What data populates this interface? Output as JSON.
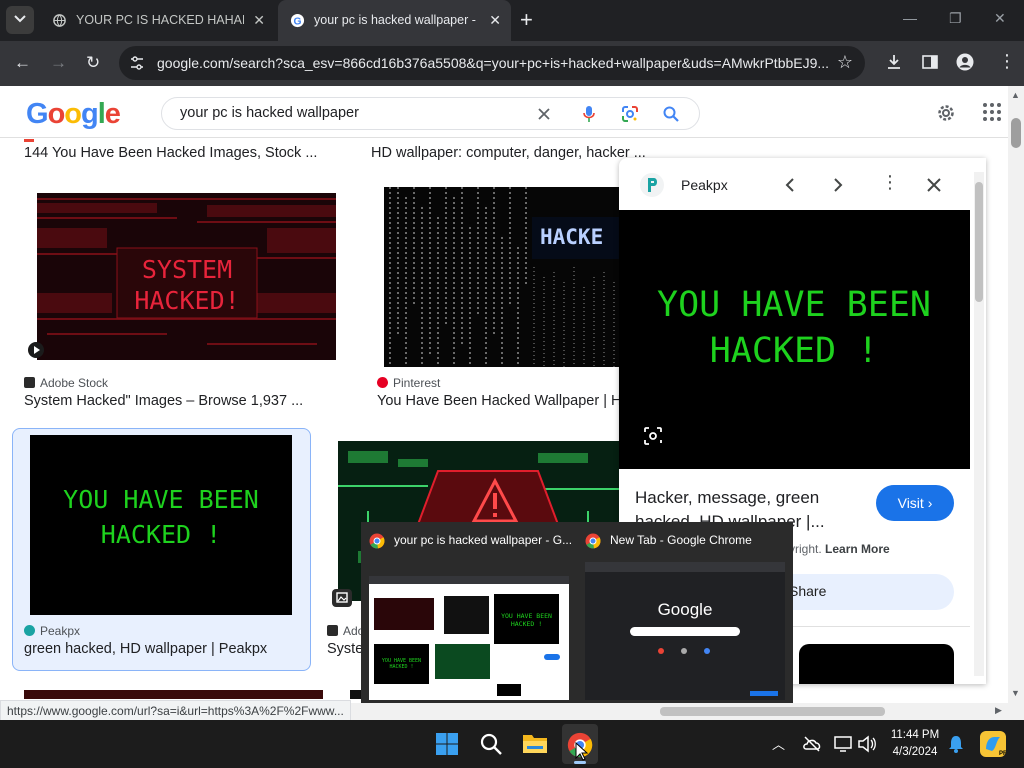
{
  "browser": {
    "tabs": [
      {
        "title": "YOUR PC IS HACKED HAHAHAHAHA",
        "active": false
      },
      {
        "title": "your pc is hacked wallpaper - Google Search",
        "active": true
      }
    ],
    "new_tab_symbol": "+",
    "url": "google.com/search?sca_esv=866cd16b376a5508&q=your+pc+is+hacked+wallpaper&uds=AMwkrPtbbEJ9..."
  },
  "google": {
    "logo": {
      "G": "G",
      "o1": "o",
      "o2": "o",
      "g": "g",
      "l": "l",
      "e": "e"
    },
    "query": "your pc is hacked wallpaper"
  },
  "results": {
    "top_row": [
      {
        "title": "144 You Have Been Hacked Images, Stock ..."
      },
      {
        "title": "HD wallpaper: computer, danger, hacker ..."
      }
    ],
    "row1": [
      {
        "source": "Adobe Stock",
        "title": "System Hacked\" Images – Browse 1,937 ...",
        "image_text": [
          "SYSTEM",
          "HACKED!"
        ]
      },
      {
        "source": "Pinterest",
        "title": "You Have Been Hacked Wallpaper | Ha",
        "image_text": "HACKE"
      }
    ],
    "row2": [
      {
        "source": "Peakpx",
        "title": "green hacked, HD wallpaper | Peakpx",
        "image_text": [
          "YOU HAVE BEEN",
          "HACKED !"
        ]
      },
      {
        "source": "Adobe Stock",
        "source_visible": "Ado",
        "title_visible": "Syste"
      }
    ]
  },
  "preview_panel": {
    "source": "Peakpx",
    "image_text": [
      "YOU HAVE BEEN",
      "HACKED !"
    ],
    "title_line1": "Hacker, message, green",
    "title_line2": "hacked, HD wallpaper |...",
    "visit_label": "Visit",
    "copyright_text": "yright.",
    "learn_more": "Learn More",
    "share_label": "Share"
  },
  "taskbar_preview": {
    "windows": [
      {
        "title": "your pc is hacked wallpaper - G..."
      },
      {
        "title": "New Tab - Google Chrome",
        "logo": "Google"
      }
    ]
  },
  "status_url": "https://www.google.com/url?sa=i&url=https%3A%2F%2Fwww...",
  "taskbar": {
    "time": "11:44 PM",
    "date": "4/3/2024"
  },
  "colors": {
    "accent": "#1a73e8",
    "hacker_green": "#1ed21e",
    "hacker_red": "#e8243b"
  }
}
